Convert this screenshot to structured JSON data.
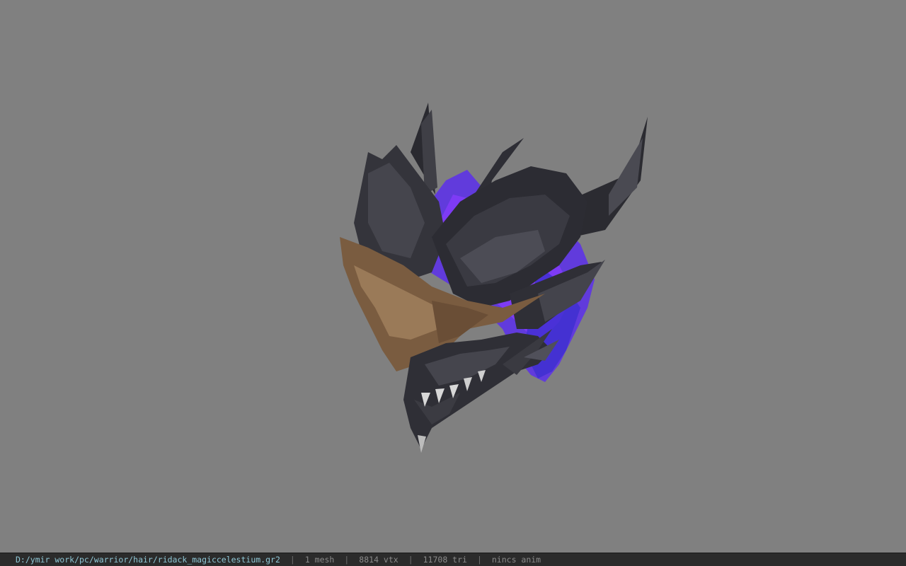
{
  "viewer": {
    "background_color": "#808080"
  },
  "model": {
    "icon": "dragon-helmet-3d-model",
    "colors": {
      "armor": "#2e2e34",
      "armor_highlight": "#5a5a62",
      "gold_trim": "#8a6a48",
      "aura": "#6a3cff"
    }
  },
  "statusbar": {
    "file_path": "D:/ymir work/pc/warrior/hair/ridack_magiccelestium.gr2",
    "separator": "|",
    "mesh_count": "1 mesh",
    "vertex_count": "8814 vtx",
    "triangle_count": "11708 tri",
    "anim_status": "nincs anim"
  }
}
